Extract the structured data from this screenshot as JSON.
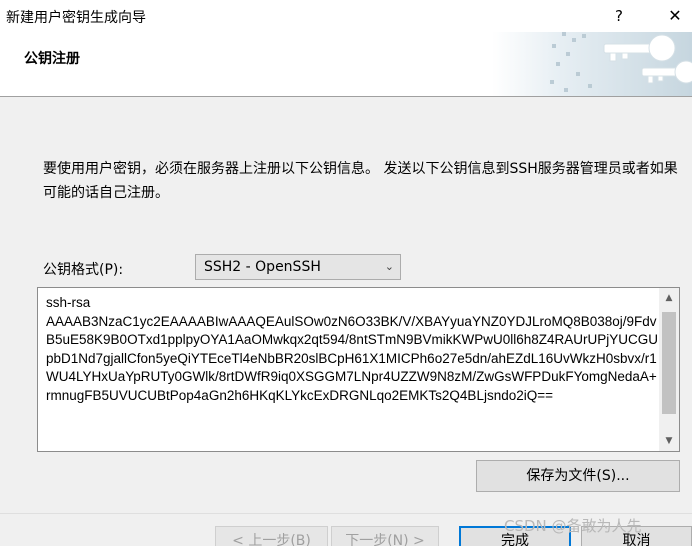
{
  "window": {
    "title": "新建用户密钥生成向导",
    "help_label": "?",
    "close_label": "✕"
  },
  "header": {
    "title": "公钥注册"
  },
  "content": {
    "description": "要使用用户密钥，必须在服务器上注册以下公钥信息。 发送以下公钥信息到SSH服务器管理员或者如果可能的话自己注册。",
    "format_label": "公钥格式(P):",
    "format_value": "SSH2 - OpenSSH",
    "key_text": "ssh-rsa\nAAAAB3NzaC1yc2EAAAABIwAAAQEAulSOw0zN6O33BK/V/XBAYyuaYNZ0YDJLroMQ8B038oj/9FdvB5uE58K9B0OTxd1pplpyOYA1AaOMwkqx2qt594/8ntSTmN9BVmikKWPwU0ll6h8Z4RAUrUPjYUCGUpbD1Nd7gjallCfon5yeQiYTEceTl4eNbBR20slBCpH61X1MICPh6o27e5dn/ahEZdL16UvWkzH0sbvx/r1WU4LYHxUaYpRUTy0GWlk/8rtDWfR9iq0XSGGM7LNpr4UZZW9N8zM/ZwGsWFPDukFYomgNedaA+rmnugFB5UVUCUBtPop4aGn2h6HKqKLYkcExDRGNLqo2EMKTs2Q4BLjsndo2iQ==",
    "save_label": "保存为文件(S)..."
  },
  "footer": {
    "back_label": "< 上一步(B)",
    "next_label": "下一步(N) >",
    "finish_label": "完成",
    "cancel_label": "取消",
    "watermark": "CSDN @备敢为人先"
  },
  "colors": {
    "accent": "#0078d7",
    "content_bg": "#f0f0f0"
  }
}
